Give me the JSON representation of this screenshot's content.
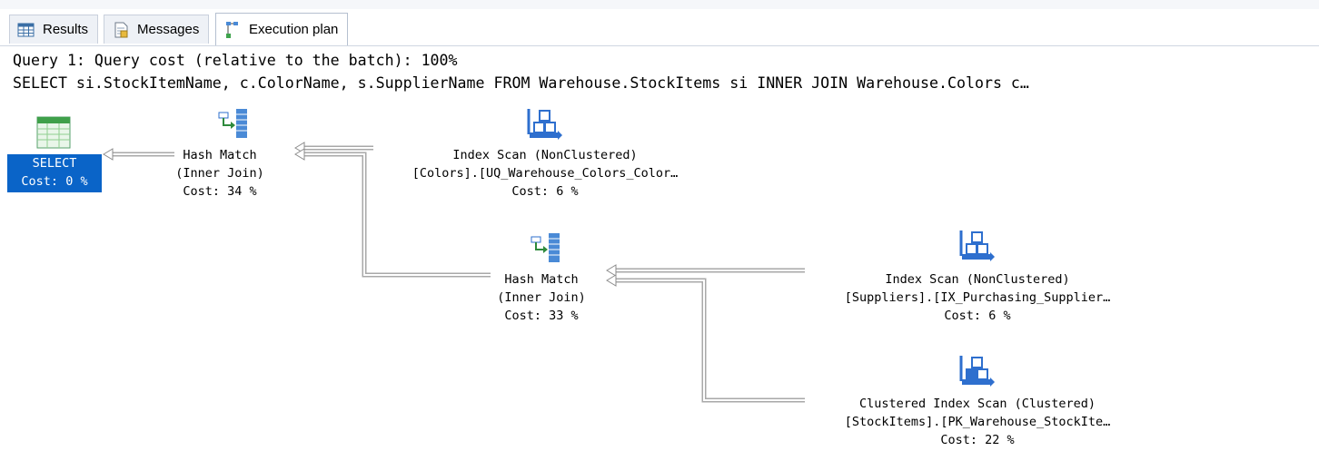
{
  "tabs": [
    {
      "label": "Results",
      "icon": "grid-icon"
    },
    {
      "label": "Messages",
      "icon": "document-icon"
    },
    {
      "label": "Execution plan",
      "icon": "plan-icon",
      "active": true
    }
  ],
  "query": {
    "cost_line": "Query 1: Query cost (relative to the batch): 100%",
    "sql": "SELECT si.StockItemName, c.ColorName, s.SupplierName FROM Warehouse.StockItems si INNER JOIN Warehouse.Colors c…"
  },
  "plan": {
    "select": {
      "line1": "SELECT",
      "line2": "Cost: 0 %",
      "icon": "result-table-icon"
    },
    "hash_match_1": {
      "line1": "Hash Match",
      "line2": "(Inner Join)",
      "line3": "Cost: 34 %",
      "icon": "hash-match-icon"
    },
    "index_scan_colors": {
      "line1": "Index Scan (NonClustered)",
      "line2": "[Colors].[UQ_Warehouse_Colors_Color…",
      "line3": "Cost: 6 %",
      "icon": "index-scan-icon"
    },
    "hash_match_2": {
      "line1": "Hash Match",
      "line2": "(Inner Join)",
      "line3": "Cost: 33 %",
      "icon": "hash-match-icon"
    },
    "index_scan_suppliers": {
      "line1": "Index Scan (NonClustered)",
      "line2": "[Suppliers].[IX_Purchasing_Supplier…",
      "line3": "Cost: 6 %",
      "icon": "index-scan-icon"
    },
    "clustered_scan_stockitems": {
      "line1": "Clustered Index Scan (Clustered)",
      "line2": "[StockItems].[PK_Warehouse_StockIte…",
      "line3": "Cost: 22 %",
      "icon": "clustered-index-scan-icon"
    }
  },
  "colors": {
    "select_bg": "#0a64c8",
    "connector": "#a8a8a8",
    "icon_blue": "#2e6fce"
  }
}
